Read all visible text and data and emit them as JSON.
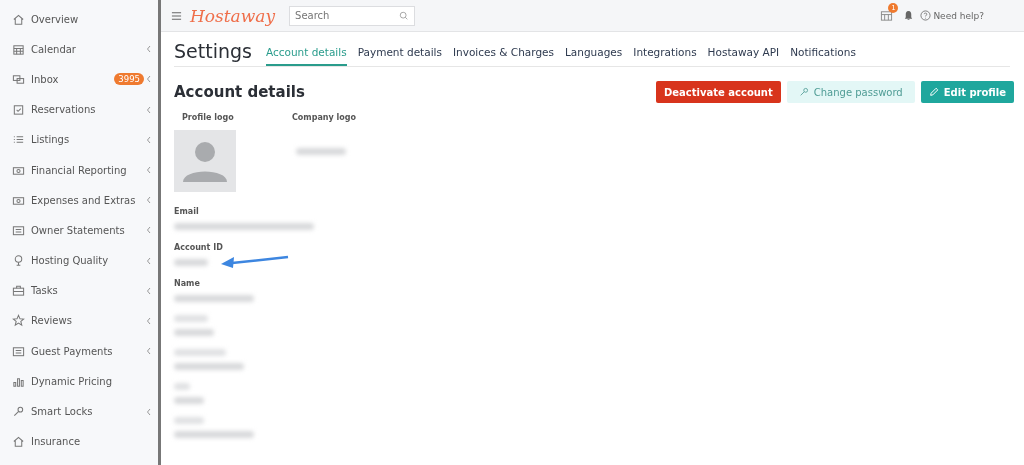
{
  "sidebar": {
    "items": [
      {
        "label": "Overview",
        "expandable": false
      },
      {
        "label": "Calendar",
        "expandable": true
      },
      {
        "label": "Inbox",
        "expandable": true,
        "badge": "3995"
      },
      {
        "label": "Reservations",
        "expandable": true
      },
      {
        "label": "Listings",
        "expandable": true
      },
      {
        "label": "Financial Reporting",
        "expandable": true
      },
      {
        "label": "Expenses and Extras",
        "expandable": true
      },
      {
        "label": "Owner Statements",
        "expandable": true
      },
      {
        "label": "Hosting Quality",
        "expandable": true
      },
      {
        "label": "Tasks",
        "expandable": true
      },
      {
        "label": "Reviews",
        "expandable": true
      },
      {
        "label": "Guest Payments",
        "expandable": true
      },
      {
        "label": "Dynamic Pricing",
        "expandable": false
      },
      {
        "label": "Smart Locks",
        "expandable": true
      },
      {
        "label": "Insurance",
        "expandable": false
      }
    ]
  },
  "header": {
    "logo": "Hostaway",
    "search": {
      "placeholder": "Search"
    },
    "notification_count": "1",
    "help": "Need help?"
  },
  "page": {
    "title": "Settings",
    "tabs": [
      {
        "label": "Account details",
        "selected": true
      },
      {
        "label": "Payment details",
        "selected": false
      },
      {
        "label": "Invoices & Charges",
        "selected": false
      },
      {
        "label": "Languages",
        "selected": false
      },
      {
        "label": "Integrations",
        "selected": false
      },
      {
        "label": "Hostaway API",
        "selected": false
      },
      {
        "label": "Notifications",
        "selected": false
      }
    ]
  },
  "section": {
    "title": "Account details",
    "buttons": [
      {
        "label": "Deactivate account",
        "kind": "danger"
      },
      {
        "label": "Change password",
        "kind": "light"
      },
      {
        "label": "Edit profile",
        "kind": "primary"
      }
    ],
    "profile_logo_label": "Profile logo",
    "company_logo_label": "Company logo",
    "fields": [
      {
        "kind": "labeled",
        "label": "Email"
      },
      {
        "kind": "labeled",
        "label": "Account ID"
      },
      {
        "kind": "labeled",
        "label": "Name"
      },
      {
        "kind": "blurred"
      },
      {
        "kind": "blurred"
      },
      {
        "kind": "blurred"
      },
      {
        "kind": "blurred"
      }
    ]
  }
}
